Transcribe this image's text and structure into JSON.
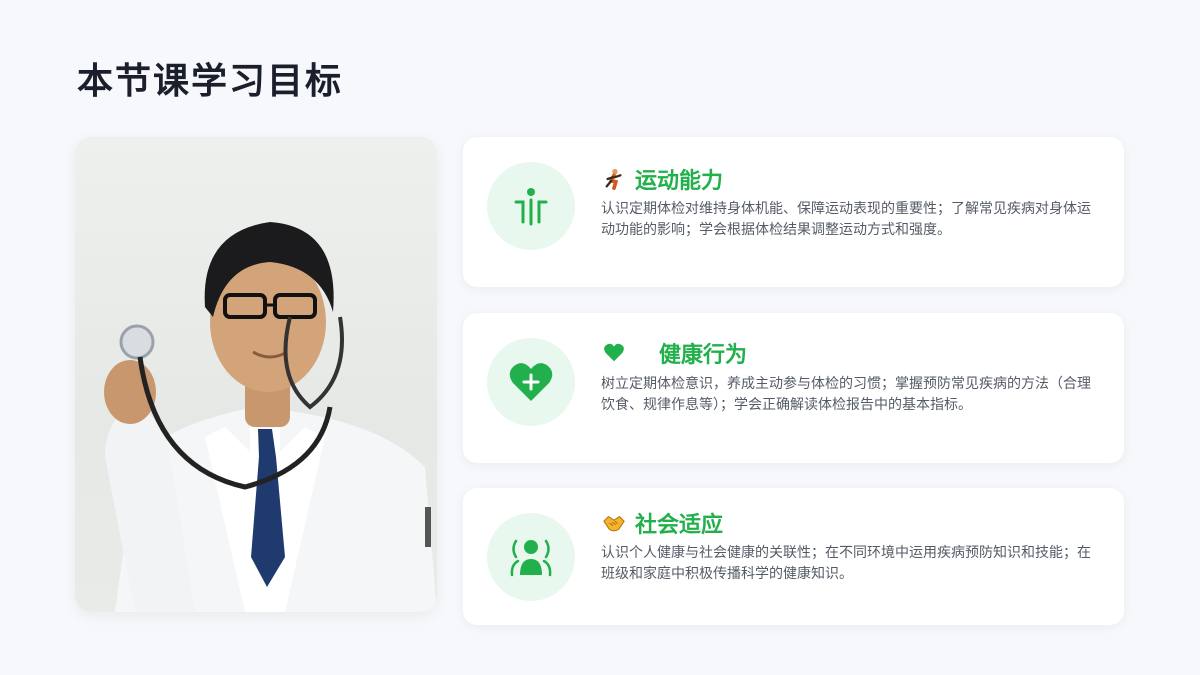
{
  "page": {
    "title": "本节课学习目标"
  },
  "goals": [
    {
      "title": "运动能力",
      "emoji_icon": "running-person-icon",
      "icon": "person-standing-icon",
      "description": "认识定期体检对维持身体机能、保障运动表现的重要性；了解常见疾病对身体运动功能的影响；学会根据体检结果调整运动方式和强度。"
    },
    {
      "title": "健康行为",
      "emoji_icon": "heart-icon",
      "icon": "heart-plus-icon",
      "description": "树立定期体检意识，养成主动参与体检的习惯；掌握预防常见疾病的方法（合理饮食、规律作息等）；学会正确解读体检报告中的基本指标。"
    },
    {
      "title": "社会适应",
      "emoji_icon": "handshake-icon",
      "icon": "person-broadcast-icon",
      "description": "认识个人健康与社会健康的关联性；在不同环境中运用疾病预防知识和技能；在班级和家庭中积极传播科学的健康知识。"
    }
  ],
  "colors": {
    "accent": "#21b04b",
    "icon_bg": "#e8f8ee",
    "title": "#1a1f2b",
    "text": "#555b66"
  }
}
